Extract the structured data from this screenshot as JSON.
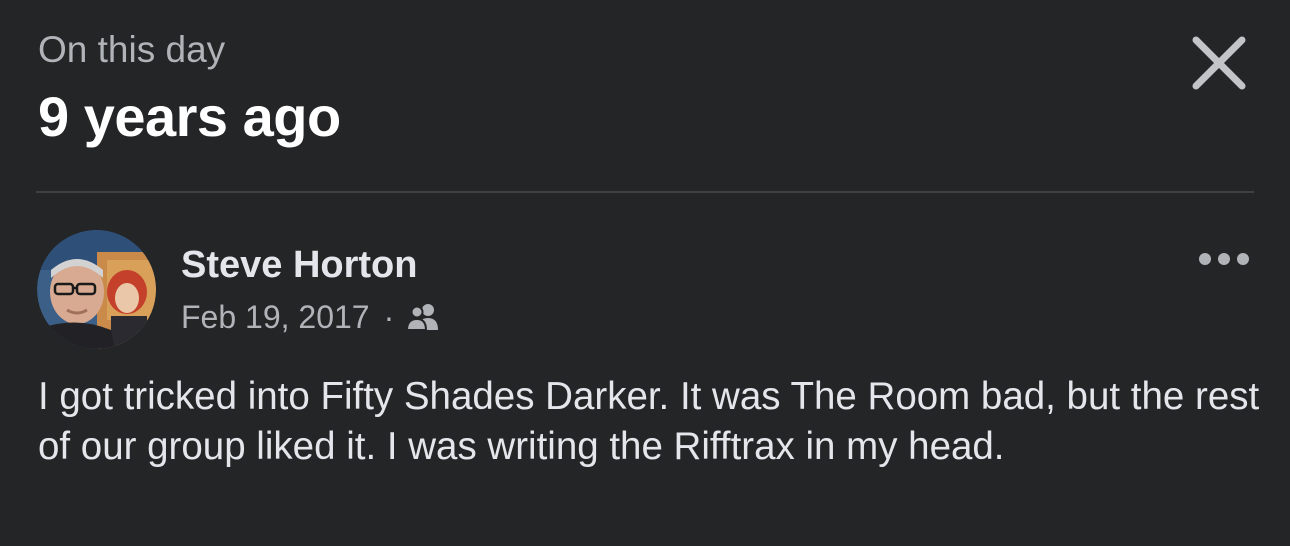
{
  "header": {
    "subtitle": "On this day",
    "title": "9 years ago",
    "close_icon": "close-icon"
  },
  "post": {
    "author": {
      "name": "Steve Horton",
      "avatar_icon": "profile-photo"
    },
    "date": "Feb 19, 2017",
    "separator": "·",
    "audience_icon": "friends-icon",
    "more_icon": "more-options-icon",
    "text": "I got tricked into Fifty Shades Darker. It was The Room bad, but the rest of our group liked it. I was writing the Rifftrax in my head."
  },
  "colors": {
    "background": "#242526",
    "primary_text": "#e4e6eb",
    "secondary_text": "#b0b3b8",
    "divider": "#3e4042"
  }
}
